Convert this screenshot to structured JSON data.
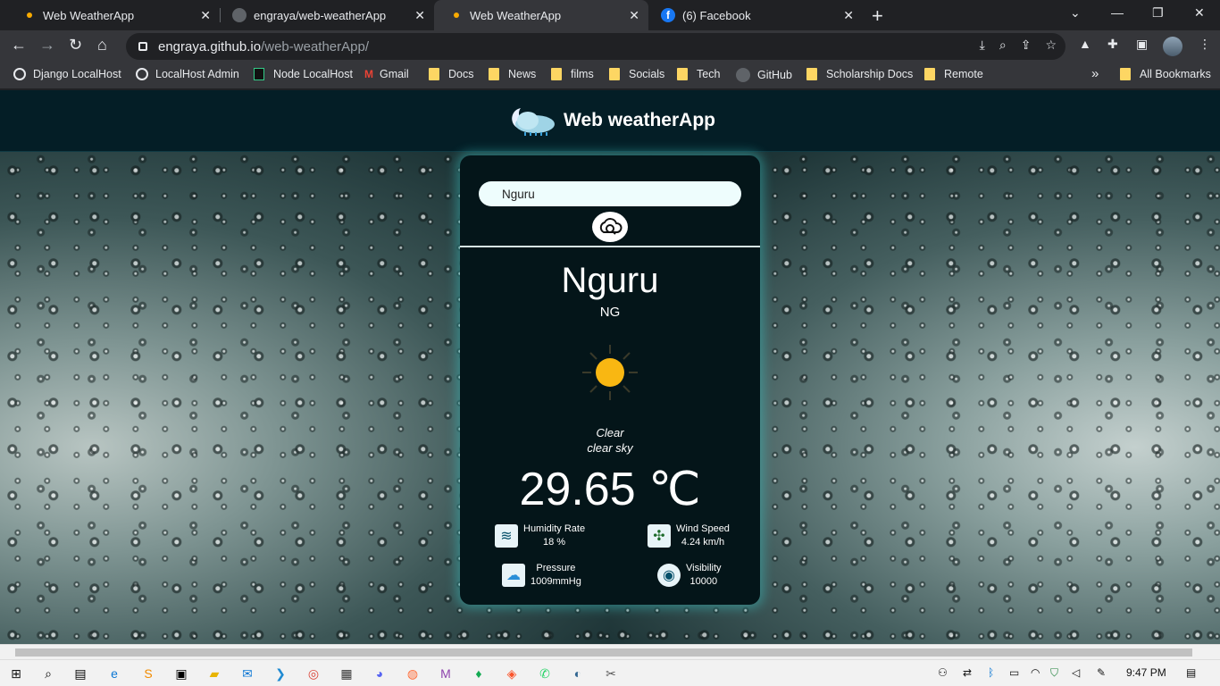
{
  "browser": {
    "tabs": [
      {
        "title": "Web WeatherApp"
      },
      {
        "title": "engraya/web-weatherApp"
      },
      {
        "title": "Web WeatherApp"
      },
      {
        "title": "(6) Facebook"
      }
    ],
    "url_host": "engraya.github.io",
    "url_path": "/web-weatherApp/",
    "bookmarks": [
      "Django LocalHost",
      "LocalHost Admin",
      "Node LocalHost",
      "Gmail",
      "Docs",
      "News",
      "films",
      "Socials",
      "Tech",
      "GitHub",
      "Scholarship Docs",
      "Remote"
    ],
    "overflow_label": "»",
    "all_bookmarks": "All Bookmarks"
  },
  "app": {
    "title": "Web weatherApp",
    "search_value": "Nguru",
    "city": "Nguru",
    "country": "NG",
    "condition": "Clear",
    "description": "clear sky",
    "temperature": "29.65 ℃",
    "stats": {
      "humidity_label": "Humidity Rate",
      "humidity_value": "18 %",
      "wind_label": "Wind Speed",
      "wind_value": "4.24 km/h",
      "pressure_label": "Pressure",
      "pressure_value": "1009mmHg",
      "visibility_label": "Visibility",
      "visibility_value": "10000"
    }
  },
  "taskbar": {
    "time": "9:47 PM"
  },
  "colors": {
    "accent": "#3cc8c8",
    "card": "#041519",
    "header": "#041e26",
    "sun": "#f9b712"
  }
}
